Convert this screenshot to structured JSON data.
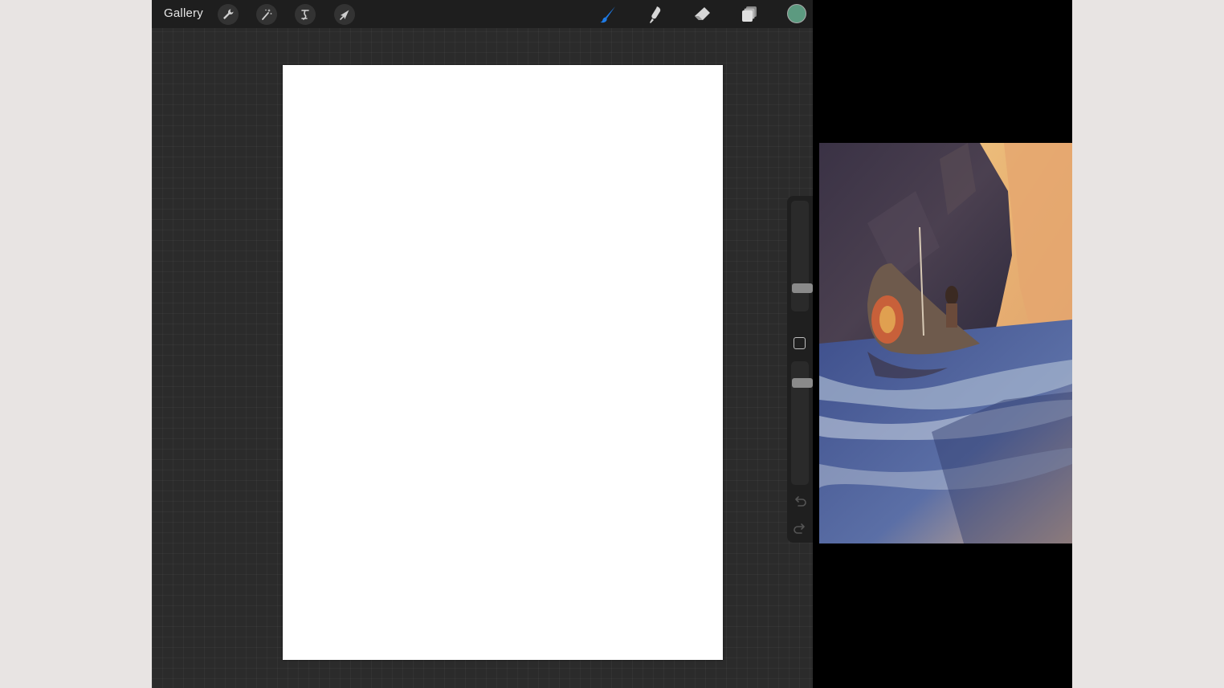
{
  "toolbar": {
    "gallery_label": "Gallery",
    "left_tools": [
      {
        "icon": "wrench-icon",
        "name": "actions"
      },
      {
        "icon": "magic-wand-icon",
        "name": "adjustments"
      },
      {
        "icon": "selection-icon",
        "name": "selection"
      },
      {
        "icon": "arrow-cursor-icon",
        "name": "transform"
      }
    ],
    "right_tools": [
      {
        "icon": "brush-icon",
        "name": "brush",
        "active": true
      },
      {
        "icon": "smudge-icon",
        "name": "smudge"
      },
      {
        "icon": "eraser-icon",
        "name": "eraser"
      },
      {
        "icon": "layers-icon",
        "name": "layers"
      }
    ],
    "current_color": "#5c9a80"
  },
  "sidebar": {
    "brush_size": 0.18,
    "opacity": 0.85
  },
  "colors": {
    "accent": "#1e7be6",
    "toolbar_bg": "#1e1e1e",
    "canvas_bg": "#2b2b2b"
  }
}
